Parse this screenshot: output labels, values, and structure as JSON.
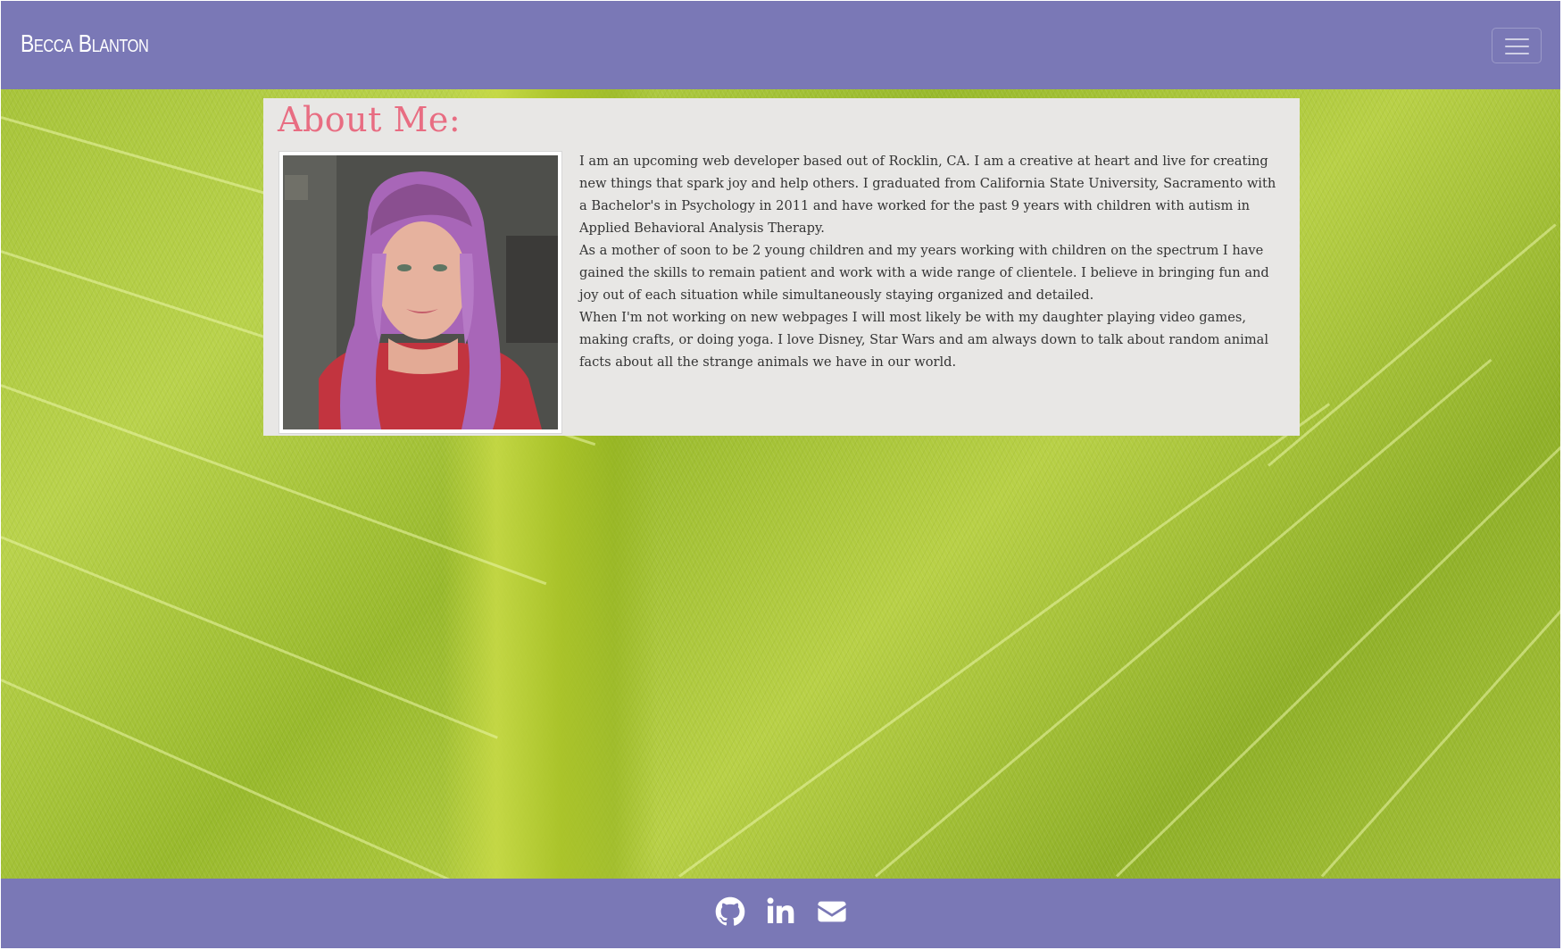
{
  "navbar": {
    "brand": "Becca Blanton",
    "toggle_icon": "hamburger-menu-icon"
  },
  "about": {
    "title": "About Me:",
    "photo_icon": "profile-photo",
    "paragraphs": [
      "I am an upcoming web developer based out of Rocklin, CA. I am a creative at heart and live for creating new things that spark joy and help others. I graduated from California State University, Sacramento with a Bachelor's in Psychology in 2011 and have worked for the past 9 years with children with autism in Applied Behavioral Analysis Therapy.",
      "As a mother of soon to be 2 young children and my years working with children on the spectrum I have gained the skills to remain patient and work with a wide range of clientele. I believe in bringing fun and joy out of each situation while simultaneously staying organized and detailed.",
      "When I'm not working on new webpages I will most likely be with my daughter playing video games, making crafts, or doing yoga. I love Disney, Star Wars and am always down to talk about random animal facts about all the strange animals we have in our world."
    ]
  },
  "footer": {
    "links": [
      {
        "icon": "github-icon"
      },
      {
        "icon": "linkedin-icon"
      },
      {
        "icon": "envelope-icon"
      }
    ]
  },
  "colors": {
    "nav_bg": "#7a78b6",
    "title_pink": "#e86d82",
    "card_bg": "#e8e7e5",
    "leaf_green": "#a7c43a"
  }
}
